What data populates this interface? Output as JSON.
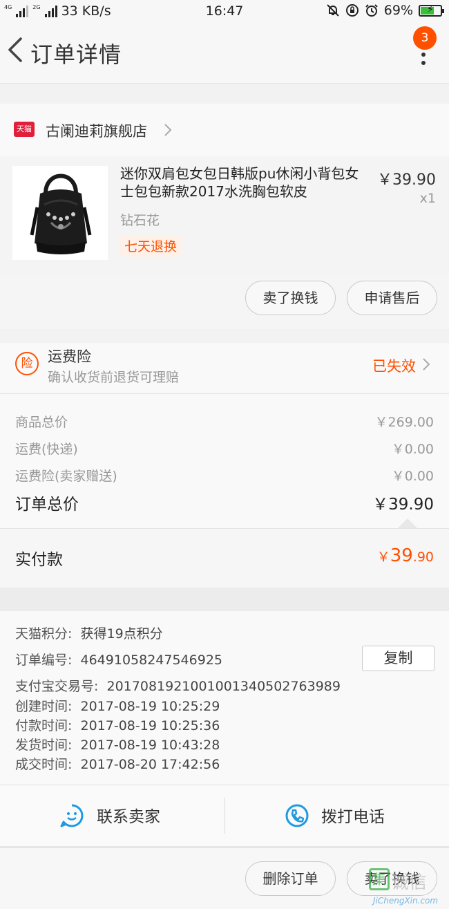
{
  "status_bar": {
    "net_left": "4G",
    "net_right": "2G",
    "speed": "33 KB/s",
    "time": "16:47",
    "battery": "69%",
    "battery_level": 0.69
  },
  "nav": {
    "title": "订单详情",
    "badge_count": "3"
  },
  "shop": {
    "platform_logo": "天猫",
    "name": "古阑迪莉旗舰店"
  },
  "item": {
    "title": "迷你双肩包女包日韩版pu休闲小背包女士包包新款2017水洗胸包软皮",
    "sku": "钻石花",
    "tag": "七天退换",
    "price": "￥39.90",
    "quantity": "x1"
  },
  "item_actions": {
    "sell_label": "卖了换钱",
    "aftersale_label": "申请售后"
  },
  "insurance": {
    "icon_char": "险",
    "title": "运费险",
    "subtitle": "确认收货前退货可理赔",
    "status": "已失效"
  },
  "price_summary": {
    "lines": [
      {
        "label": "商品总价",
        "value": "￥269.00"
      },
      {
        "label": "运费(快递)",
        "value": "￥0.00"
      },
      {
        "label": "运费险(卖家赠送)",
        "value": "￥0.00"
      }
    ],
    "total_label": "订单总价",
    "total_value": "￥39.90"
  },
  "payment": {
    "label": "实付款",
    "currency": "￥",
    "integer": "39",
    "decimal": ".90"
  },
  "order_info": {
    "points_label": "天猫积分:",
    "points_value": "获得19点积分",
    "order_no_label": "订单编号:",
    "order_no_value": "46491058247546925",
    "copy_label": "复制",
    "alipay_label": "支付宝交易号:",
    "alipay_value": "2017081921001001340502763989",
    "created_label": "创建时间:",
    "created_value": "2017-08-19 10:25:29",
    "paid_label": "付款时间:",
    "paid_value": "2017-08-19 10:25:36",
    "shipped_label": "发货时间:",
    "shipped_value": "2017-08-19 10:43:28",
    "closed_label": "成交时间:",
    "closed_value": "2017-08-20 17:42:56"
  },
  "contact": {
    "seller_label": "联系卖家",
    "call_label": "拨打电话"
  },
  "bottom_actions": {
    "delete_label": "删除订单",
    "sell_label": "卖了换钱"
  },
  "watermark": {
    "glyph": "集",
    "cn": "诚信",
    "en": "JiChengXin.com"
  },
  "colors": {
    "accent": "#ff5000",
    "tmall_red": "#e0203a",
    "contact_blue": "#1e9ae0"
  }
}
